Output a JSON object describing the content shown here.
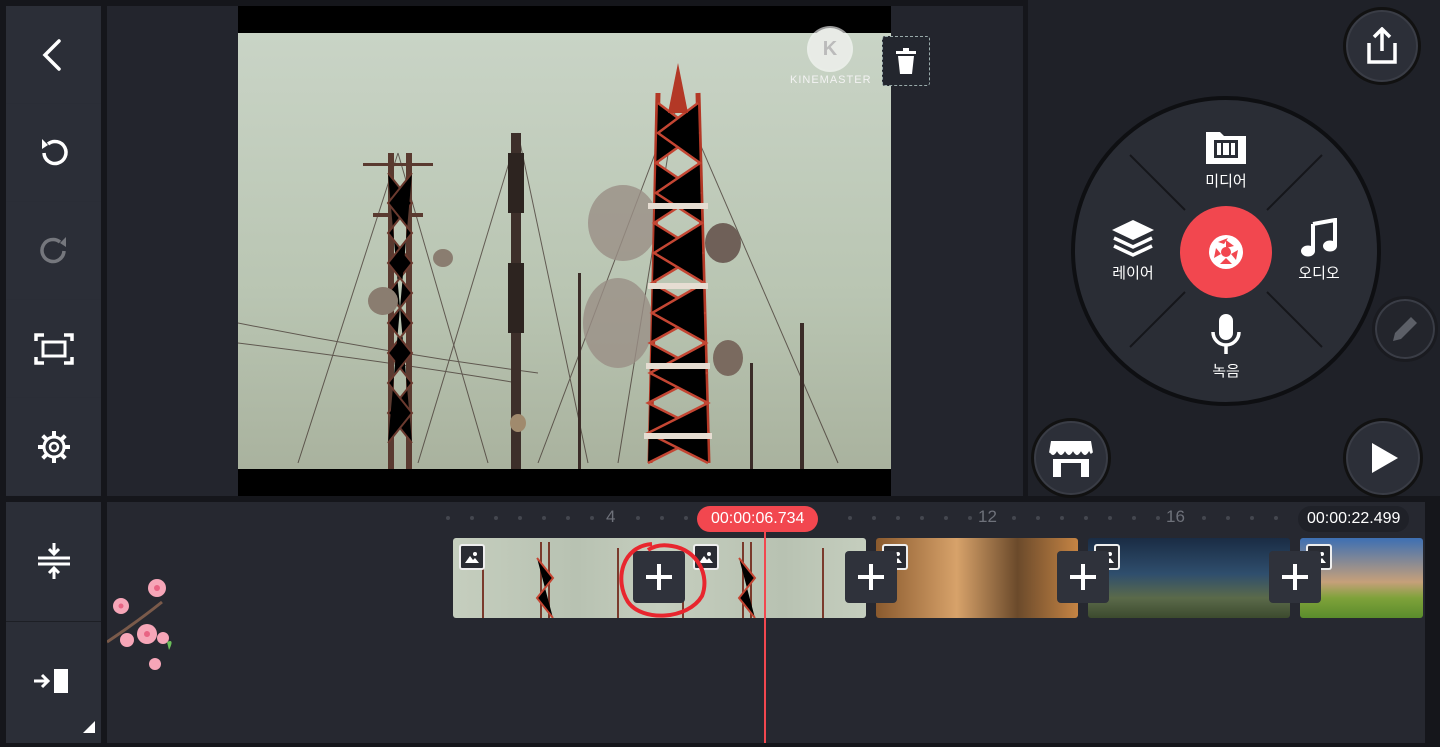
{
  "toolbar": {
    "back_icon": "chevron-left-icon",
    "undo_icon": "undo-icon",
    "redo_icon": "redo-icon",
    "fullscreen_icon": "fullscreen-icon",
    "settings_icon": "gear-icon",
    "timeline_expand_icon": "expand-vertical-icon",
    "jump_icon": "jump-to-end-icon"
  },
  "preview": {
    "watermark_text": "KINEMASTER",
    "watermark_logo": "K"
  },
  "media_wheel": {
    "media_label": "미디어",
    "layer_label": "레이어",
    "audio_label": "오디오",
    "record_label": "녹음"
  },
  "timeline": {
    "ruler_labels": [
      "4",
      "12",
      "16"
    ],
    "current_time": "00:00:06.734",
    "total_time": "00:00:22.499"
  },
  "colors": {
    "accent": "#f2474f",
    "panel": "#2b2e37",
    "background": "#15161b"
  }
}
